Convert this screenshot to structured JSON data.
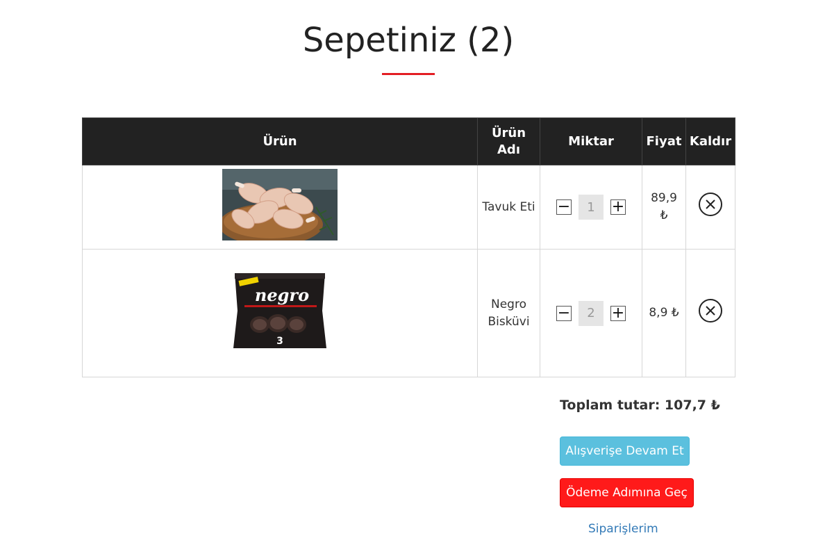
{
  "page": {
    "title": "Sepetiniz (2)"
  },
  "colors": {
    "accent": "#e31e24",
    "header_bg": "#222222",
    "continue_btn": "#5bc0de",
    "checkout_btn": "#ff1a1a",
    "link": "#337ab7"
  },
  "table": {
    "headers": {
      "product": "Ürün",
      "product_name": "Ürün Adı",
      "quantity": "Miktar",
      "price": "Fiyat",
      "remove": "Kaldır"
    },
    "rows": [
      {
        "image": "chicken-drumsticks-photo",
        "name": "Tavuk Eti",
        "quantity": "1",
        "price": "89,9 ₺",
        "minus": "−",
        "plus": "+"
      },
      {
        "image": "negro-biscuit-package-photo",
        "name": "Negro Bisküvi",
        "quantity": "2",
        "price": "8,9 ₺",
        "minus": "−",
        "plus": "+"
      }
    ]
  },
  "summary": {
    "total": "Toplam tutar: 107,7 ₺"
  },
  "actions": {
    "continue_shopping": "Alışverişe Devam Et",
    "go_to_checkout": "Ödeme Adımına Geç",
    "my_orders": "Siparişlerim"
  },
  "icons": {
    "remove": "close-circle-icon",
    "decrease": "minus-icon",
    "increase": "plus-icon"
  },
  "images": {
    "biscuit_brand_text": "negro",
    "biscuit_count_text": "3"
  }
}
